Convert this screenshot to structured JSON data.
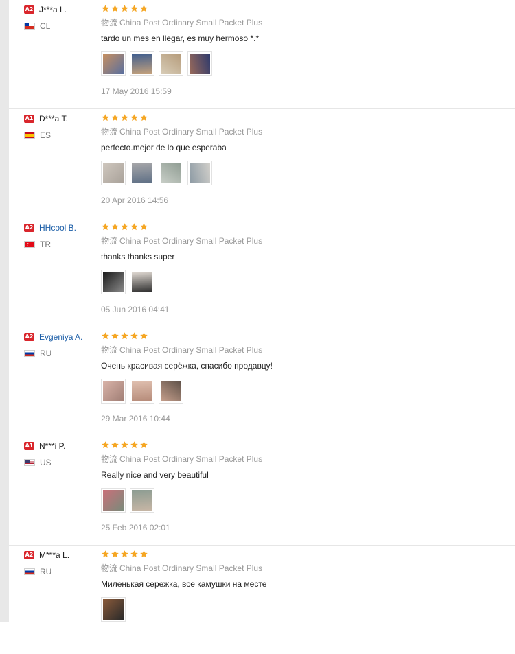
{
  "reviews": [
    {
      "level": "A2",
      "name": "J***a L.",
      "name_linked": false,
      "flag": "cl",
      "country": "CL",
      "rating": 5,
      "logistics_prefix": "物流",
      "logistics": "China Post Ordinary Small Packet Plus",
      "comment": "tardo un mes en llegar, es muy hermoso *.*",
      "date": "17 May 2016 15:59",
      "photos": [
        {
          "name": "photo-1",
          "colors": [
            "#c89060",
            "#5a6f9e"
          ]
        },
        {
          "name": "photo-2",
          "colors": [
            "#3e5d8f",
            "#c5a27c"
          ]
        },
        {
          "name": "photo-3",
          "colors": [
            "#b59b7a",
            "#d8cdb8"
          ]
        },
        {
          "name": "photo-4",
          "colors": [
            "#2e3a6c",
            "#9a6a5a"
          ]
        }
      ]
    },
    {
      "level": "A1",
      "name": "D***a T.",
      "name_linked": false,
      "flag": "es",
      "country": "ES",
      "rating": 5,
      "logistics_prefix": "物流",
      "logistics": "China Post Ordinary Small Packet Plus",
      "comment": "perfecto.mejor de lo que esperaba",
      "date": "20 Apr 2016 14:56",
      "photos": [
        {
          "name": "photo-1",
          "colors": [
            "#cfc7be",
            "#a9a29a"
          ]
        },
        {
          "name": "photo-2",
          "colors": [
            "#a8a8aa",
            "#5e6f85"
          ]
        },
        {
          "name": "photo-3",
          "colors": [
            "#8f9c92",
            "#c9cfc8"
          ]
        },
        {
          "name": "photo-4",
          "colors": [
            "#d2d0cb",
            "#8c9aa4"
          ]
        }
      ]
    },
    {
      "level": "A2",
      "name": "HHcool B.",
      "name_linked": true,
      "flag": "tr",
      "country": "TR",
      "rating": 5,
      "logistics_prefix": "物流",
      "logistics": "China Post Ordinary Small Packet Plus",
      "comment": "thanks thanks super",
      "date": "05 Jun 2016 04:41",
      "photos": [
        {
          "name": "photo-1",
          "colors": [
            "#1a1a1a",
            "#8a8a8a"
          ]
        },
        {
          "name": "photo-2",
          "colors": [
            "#e3dcd5",
            "#2b2b2b"
          ]
        }
      ]
    },
    {
      "level": "A2",
      "name": "Evgeniya A.",
      "name_linked": true,
      "flag": "ru",
      "country": "RU",
      "rating": 5,
      "logistics_prefix": "物流",
      "logistics": "China Post Ordinary Small Packet Plus",
      "comment": "Очень красивая серёжка, спасибо продавцу!",
      "date": "29 Mar 2016 10:44",
      "photos": [
        {
          "name": "photo-1",
          "colors": [
            "#d9b3a8",
            "#a07e75"
          ]
        },
        {
          "name": "photo-2",
          "colors": [
            "#e0c0b0",
            "#b58a78"
          ]
        },
        {
          "name": "photo-3",
          "colors": [
            "#5e5148",
            "#c7a08d"
          ]
        }
      ]
    },
    {
      "level": "A1",
      "name": "N***i P.",
      "name_linked": false,
      "flag": "us",
      "country": "US",
      "rating": 5,
      "logistics_prefix": "物流",
      "logistics": "China Post Ordinary Small Packet Plus",
      "comment": "Really nice and very beautiful",
      "date": "25 Feb 2016 02:01",
      "photos": [
        {
          "name": "photo-1",
          "colors": [
            "#c9707a",
            "#7a8a7a"
          ]
        },
        {
          "name": "photo-2",
          "colors": [
            "#8c9c92",
            "#c7b6a5"
          ]
        }
      ]
    },
    {
      "level": "A2",
      "name": "M***a L.",
      "name_linked": false,
      "flag": "ru",
      "country": "RU",
      "rating": 5,
      "logistics_prefix": "物流",
      "logistics": "China Post Ordinary Small Packet Plus",
      "comment": "Миленькая сережка, все камушки на месте",
      "date": "",
      "photos": [
        {
          "name": "photo-1",
          "colors": [
            "#8a5a3a",
            "#2a2a2a"
          ]
        }
      ]
    }
  ]
}
